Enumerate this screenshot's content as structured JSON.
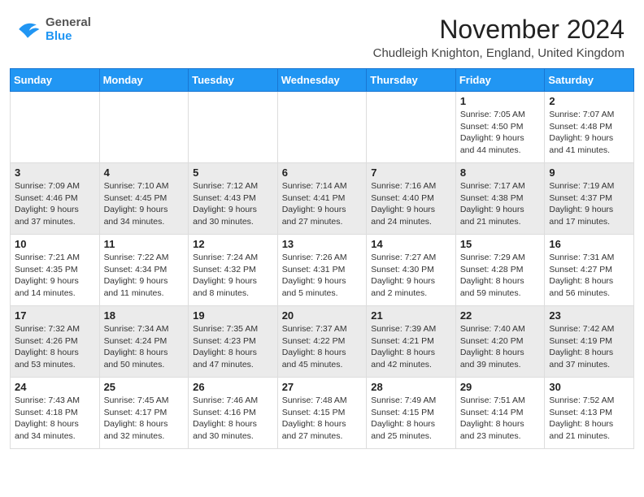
{
  "header": {
    "logo_general": "General",
    "logo_blue": "Blue",
    "month_title": "November 2024",
    "location": "Chudleigh Knighton, England, United Kingdom"
  },
  "weekdays": [
    "Sunday",
    "Monday",
    "Tuesday",
    "Wednesday",
    "Thursday",
    "Friday",
    "Saturday"
  ],
  "weeks": [
    [
      {
        "day": "",
        "info": ""
      },
      {
        "day": "",
        "info": ""
      },
      {
        "day": "",
        "info": ""
      },
      {
        "day": "",
        "info": ""
      },
      {
        "day": "",
        "info": ""
      },
      {
        "day": "1",
        "info": "Sunrise: 7:05 AM\nSunset: 4:50 PM\nDaylight: 9 hours\nand 44 minutes."
      },
      {
        "day": "2",
        "info": "Sunrise: 7:07 AM\nSunset: 4:48 PM\nDaylight: 9 hours\nand 41 minutes."
      }
    ],
    [
      {
        "day": "3",
        "info": "Sunrise: 7:09 AM\nSunset: 4:46 PM\nDaylight: 9 hours\nand 37 minutes."
      },
      {
        "day": "4",
        "info": "Sunrise: 7:10 AM\nSunset: 4:45 PM\nDaylight: 9 hours\nand 34 minutes."
      },
      {
        "day": "5",
        "info": "Sunrise: 7:12 AM\nSunset: 4:43 PM\nDaylight: 9 hours\nand 30 minutes."
      },
      {
        "day": "6",
        "info": "Sunrise: 7:14 AM\nSunset: 4:41 PM\nDaylight: 9 hours\nand 27 minutes."
      },
      {
        "day": "7",
        "info": "Sunrise: 7:16 AM\nSunset: 4:40 PM\nDaylight: 9 hours\nand 24 minutes."
      },
      {
        "day": "8",
        "info": "Sunrise: 7:17 AM\nSunset: 4:38 PM\nDaylight: 9 hours\nand 21 minutes."
      },
      {
        "day": "9",
        "info": "Sunrise: 7:19 AM\nSunset: 4:37 PM\nDaylight: 9 hours\nand 17 minutes."
      }
    ],
    [
      {
        "day": "10",
        "info": "Sunrise: 7:21 AM\nSunset: 4:35 PM\nDaylight: 9 hours\nand 14 minutes."
      },
      {
        "day": "11",
        "info": "Sunrise: 7:22 AM\nSunset: 4:34 PM\nDaylight: 9 hours\nand 11 minutes."
      },
      {
        "day": "12",
        "info": "Sunrise: 7:24 AM\nSunset: 4:32 PM\nDaylight: 9 hours\nand 8 minutes."
      },
      {
        "day": "13",
        "info": "Sunrise: 7:26 AM\nSunset: 4:31 PM\nDaylight: 9 hours\nand 5 minutes."
      },
      {
        "day": "14",
        "info": "Sunrise: 7:27 AM\nSunset: 4:30 PM\nDaylight: 9 hours\nand 2 minutes."
      },
      {
        "day": "15",
        "info": "Sunrise: 7:29 AM\nSunset: 4:28 PM\nDaylight: 8 hours\nand 59 minutes."
      },
      {
        "day": "16",
        "info": "Sunrise: 7:31 AM\nSunset: 4:27 PM\nDaylight: 8 hours\nand 56 minutes."
      }
    ],
    [
      {
        "day": "17",
        "info": "Sunrise: 7:32 AM\nSunset: 4:26 PM\nDaylight: 8 hours\nand 53 minutes."
      },
      {
        "day": "18",
        "info": "Sunrise: 7:34 AM\nSunset: 4:24 PM\nDaylight: 8 hours\nand 50 minutes."
      },
      {
        "day": "19",
        "info": "Sunrise: 7:35 AM\nSunset: 4:23 PM\nDaylight: 8 hours\nand 47 minutes."
      },
      {
        "day": "20",
        "info": "Sunrise: 7:37 AM\nSunset: 4:22 PM\nDaylight: 8 hours\nand 45 minutes."
      },
      {
        "day": "21",
        "info": "Sunrise: 7:39 AM\nSunset: 4:21 PM\nDaylight: 8 hours\nand 42 minutes."
      },
      {
        "day": "22",
        "info": "Sunrise: 7:40 AM\nSunset: 4:20 PM\nDaylight: 8 hours\nand 39 minutes."
      },
      {
        "day": "23",
        "info": "Sunrise: 7:42 AM\nSunset: 4:19 PM\nDaylight: 8 hours\nand 37 minutes."
      }
    ],
    [
      {
        "day": "24",
        "info": "Sunrise: 7:43 AM\nSunset: 4:18 PM\nDaylight: 8 hours\nand 34 minutes."
      },
      {
        "day": "25",
        "info": "Sunrise: 7:45 AM\nSunset: 4:17 PM\nDaylight: 8 hours\nand 32 minutes."
      },
      {
        "day": "26",
        "info": "Sunrise: 7:46 AM\nSunset: 4:16 PM\nDaylight: 8 hours\nand 30 minutes."
      },
      {
        "day": "27",
        "info": "Sunrise: 7:48 AM\nSunset: 4:15 PM\nDaylight: 8 hours\nand 27 minutes."
      },
      {
        "day": "28",
        "info": "Sunrise: 7:49 AM\nSunset: 4:15 PM\nDaylight: 8 hours\nand 25 minutes."
      },
      {
        "day": "29",
        "info": "Sunrise: 7:51 AM\nSunset: 4:14 PM\nDaylight: 8 hours\nand 23 minutes."
      },
      {
        "day": "30",
        "info": "Sunrise: 7:52 AM\nSunset: 4:13 PM\nDaylight: 8 hours\nand 21 minutes."
      }
    ]
  ]
}
